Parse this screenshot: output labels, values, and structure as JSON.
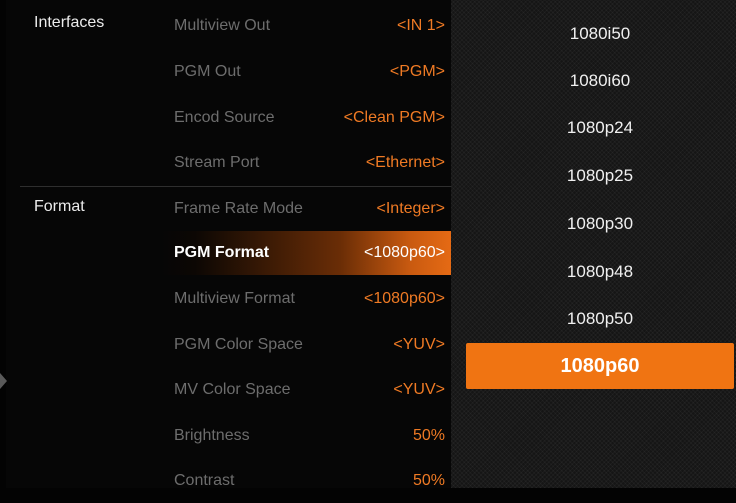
{
  "sections": {
    "interfaces": "Interfaces",
    "format": "Format"
  },
  "menu_items": [
    {
      "label": "Multiview Out",
      "value": "<IN 1>"
    },
    {
      "label": "PGM Out",
      "value": "<PGM>"
    },
    {
      "label": "Encod Source",
      "value": "<Clean PGM>"
    },
    {
      "label": "Stream Port",
      "value": "<Ethernet>"
    },
    {
      "label": "Frame Rate Mode",
      "value": "<Integer>"
    },
    {
      "label": "PGM Format",
      "value": "<1080p60>",
      "selected": true
    },
    {
      "label": "Multiview Format",
      "value": "<1080p60>"
    },
    {
      "label": "PGM Color Space",
      "value": "<YUV>"
    },
    {
      "label": "MV Color Space",
      "value": "<YUV>"
    },
    {
      "label": "Brightness",
      "value": "50%"
    },
    {
      "label": "Contrast",
      "value": "50%"
    }
  ],
  "format_options": [
    {
      "label": "1080i50"
    },
    {
      "label": "1080i60"
    },
    {
      "label": "1080p24"
    },
    {
      "label": "1080p25"
    },
    {
      "label": "1080p30"
    },
    {
      "label": "1080p48"
    },
    {
      "label": "1080p50"
    },
    {
      "label": "1080p60",
      "selected": true
    }
  ],
  "colors": {
    "accent": "#f07412",
    "value_text": "#ef7a24",
    "muted_label": "#6d6d6d"
  }
}
